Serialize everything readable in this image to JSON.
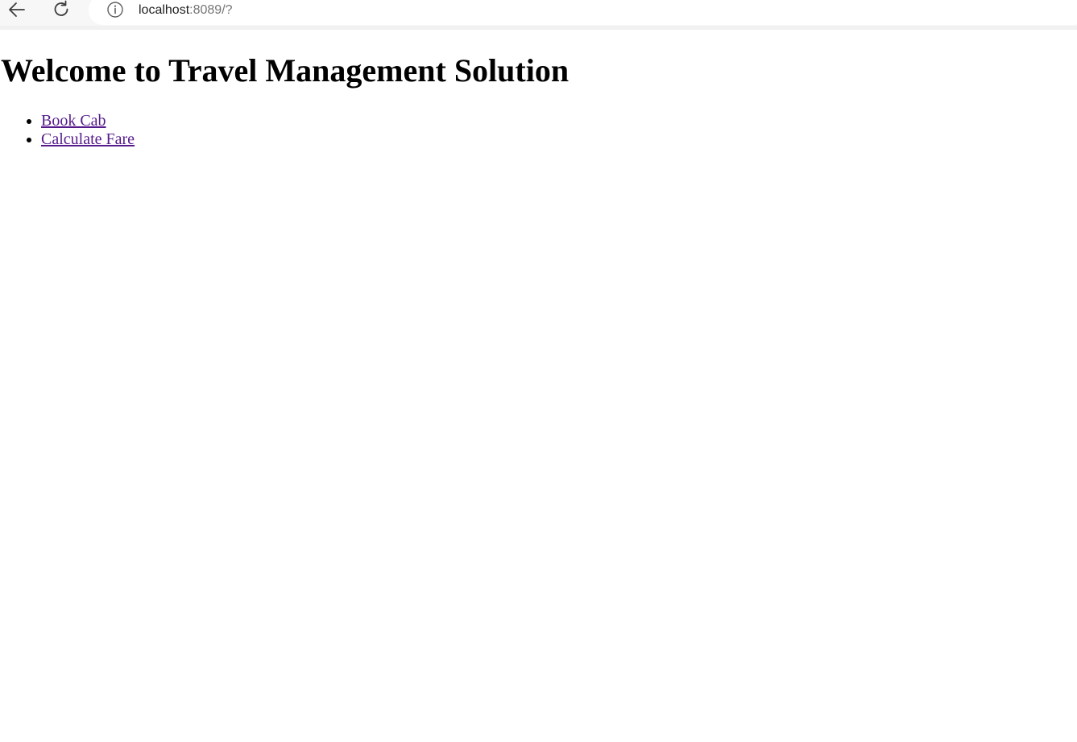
{
  "browser": {
    "url_host": "localhost",
    "url_rest": ":8089/?"
  },
  "icons": {
    "back": "arrow-left-icon",
    "reload": "reload-icon",
    "site_info": "info-icon"
  },
  "colors": {
    "visited_link": "#551a8b",
    "heading": "#000000",
    "url_secondary": "#757575"
  },
  "page": {
    "heading": "Welcome to Travel Management Solution",
    "links": [
      {
        "label": "Book Cab"
      },
      {
        "label": "Calculate Fare"
      }
    ]
  }
}
